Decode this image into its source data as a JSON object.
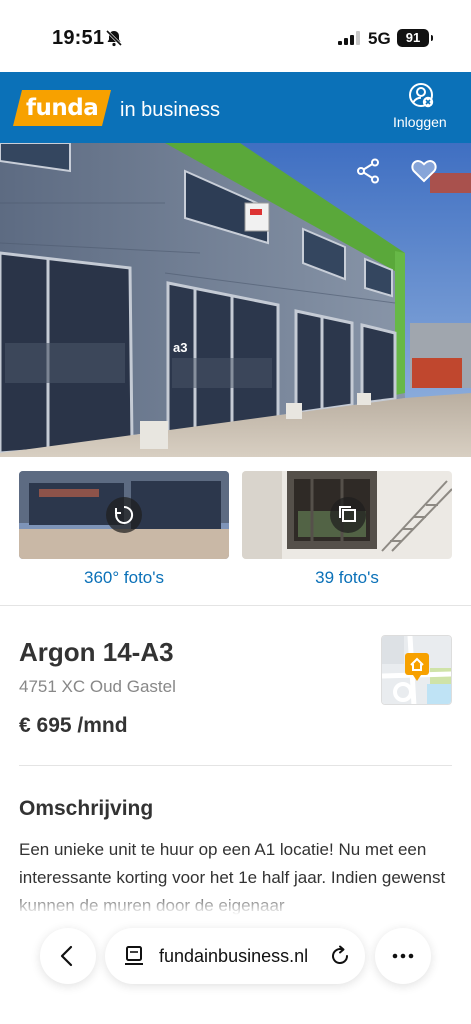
{
  "status": {
    "time": "19:51",
    "network": "5G",
    "battery": "91"
  },
  "header": {
    "logo_text": "funda",
    "brand_sub": "in business",
    "login_label": "Inloggen"
  },
  "hero": {
    "unit_label": "a3"
  },
  "media": {
    "tour_label": "360° foto's",
    "photos_label": "39 foto's"
  },
  "listing": {
    "title": "Argon 14-A3",
    "address": "4751 XC Oud Gastel",
    "price": "€ 695 /mnd"
  },
  "description": {
    "heading": "Omschrijving",
    "text": "Een unieke unit te huur op een A1 locatie! Nu met een interessante korting voor het 1e half jaar. Indien gewenst kunnen de muren door de eigenaar"
  },
  "browser": {
    "url": "fundainbusiness.nl"
  },
  "colors": {
    "brand_blue": "#0b71b8",
    "logo_orange": "#f7a100",
    "link_blue": "#0b71b8"
  },
  "icons": [
    "bell-slash-icon",
    "signal-icon",
    "login-icon",
    "share-icon",
    "heart-icon",
    "rotate-360-icon",
    "gallery-icon",
    "map-pin-icon",
    "back-icon",
    "page-icon",
    "reload-icon",
    "more-icon"
  ]
}
